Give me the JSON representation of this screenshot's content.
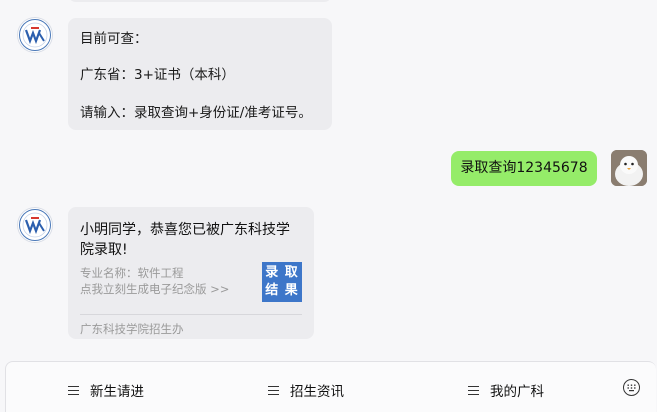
{
  "messages": {
    "msg1": {
      "lines": [
        "目前可查：",
        "广东省：3+证书（本科）",
        "请输入：录取查询+身份证/准考证号。"
      ]
    },
    "msg2": {
      "text": "录取查询12345678"
    },
    "msg3": {
      "title": "小明同学，恭喜您已被广东科技学院录取!",
      "subtitle1": "专业名称：软件工程",
      "subtitle2": "点我立刻生成电子纪念版 >>",
      "thumb_line1": "录 取",
      "thumb_line2": "结 果",
      "source": "广东科技学院招生办"
    }
  },
  "bottom_menu": {
    "item1": "新生请进",
    "item2": "招生资讯",
    "item3": "我的广科"
  },
  "colors": {
    "user_bubble": "#95ec69",
    "bot_bubble": "#ececef",
    "thumb": "#3d76c9"
  },
  "icons": [
    "school-logo-icon",
    "user-avatar",
    "menu-icon",
    "keyboard-icon"
  ]
}
